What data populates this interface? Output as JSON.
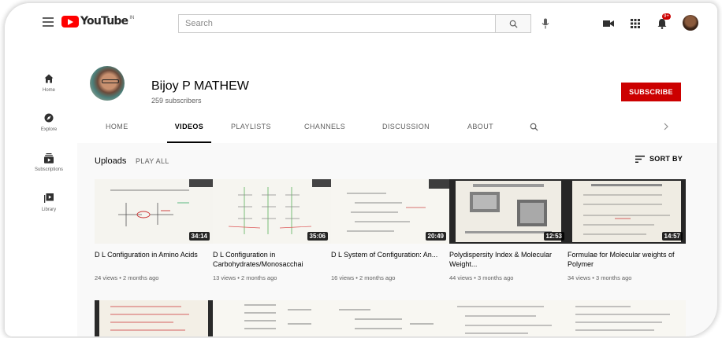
{
  "masthead": {
    "logo_text": "YouTube",
    "logo_sup": "IN",
    "search_placeholder": "Search",
    "notification_count": "9+"
  },
  "sidebar": {
    "items": [
      {
        "label": "Home",
        "icon": "home-icon"
      },
      {
        "label": "Explore",
        "icon": "compass-icon"
      },
      {
        "label": "Subscriptions",
        "icon": "subscriptions-icon"
      },
      {
        "label": "Library",
        "icon": "library-icon"
      }
    ]
  },
  "channel": {
    "name": "Bijoy P MATHEW",
    "subscribers": "259 subscribers",
    "subscribe_label": "SUBSCRIBE"
  },
  "tabs": [
    {
      "label": "HOME",
      "active": false
    },
    {
      "label": "VIDEOS",
      "active": true
    },
    {
      "label": "PLAYLISTS",
      "active": false
    },
    {
      "label": "CHANNELS",
      "active": false
    },
    {
      "label": "DISCUSSION",
      "active": false
    },
    {
      "label": "ABOUT",
      "active": false
    }
  ],
  "uploads": {
    "title": "Uploads",
    "play_all": "PLAY ALL",
    "sort_by": "SORT BY"
  },
  "videos": [
    {
      "title": "D L Configuration in Amino Acids",
      "meta": "24 views • 2 months ago",
      "duration": "34:14"
    },
    {
      "title": "D L Configuration in Carbohydrates/Monosacchai",
      "meta": "13 views • 2 months ago",
      "duration": "35:06"
    },
    {
      "title": "D L System of Configuration: An...",
      "meta": "16 views • 2 months ago",
      "duration": "20:49"
    },
    {
      "title": "Polydispersity Index & Molecular Weight...",
      "meta": "44 views • 3 months ago",
      "duration": "12:53"
    },
    {
      "title": "Formulae for Molecular weights of Polymer",
      "meta": "34 views • 3 months ago",
      "duration": "14:57"
    }
  ],
  "colors": {
    "brand_red": "#ff0000",
    "subscribe_red": "#cc0000"
  }
}
